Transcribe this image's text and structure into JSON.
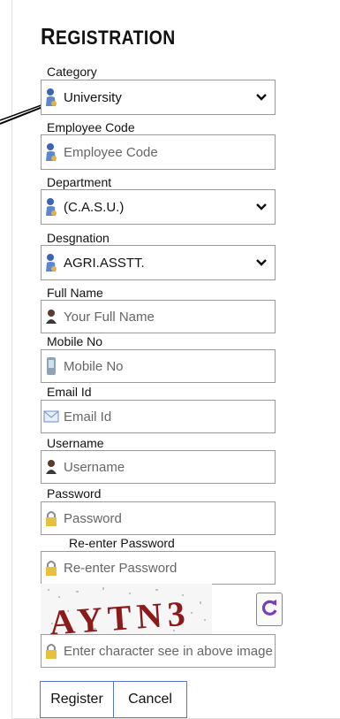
{
  "form": {
    "title_first": "R",
    "title_rest": "EGISTRATION",
    "category": {
      "label": "Category",
      "value": "University"
    },
    "employee_code": {
      "label": "Employee Code",
      "placeholder": "Employee Code"
    },
    "department": {
      "label": "Department",
      "value": "(C.A.S.U.)"
    },
    "designation": {
      "label": "Desgnation",
      "value": "AGRI.ASSTT."
    },
    "full_name": {
      "label": "Full Name",
      "placeholder": "Your Full Name"
    },
    "mobile": {
      "label": "Mobile No",
      "placeholder": "Mobile No"
    },
    "email": {
      "label": "Email Id",
      "placeholder": "Email Id"
    },
    "username": {
      "label": "Username",
      "placeholder": "Username"
    },
    "password": {
      "label": "Password",
      "placeholder": "Password"
    },
    "reenter_password": {
      "label": "Re-enter Password",
      "placeholder": "Re-enter Password"
    },
    "captcha": {
      "text": "AYTN3",
      "placeholder": "Enter character see in above image"
    },
    "buttons": {
      "register": "Register",
      "cancel": "Cancel"
    }
  },
  "colors": {
    "border": "#9a9a9a",
    "button_border": "#5577cc",
    "refresh_icon": "#7a3fb0",
    "captcha_text": "#8b1a1a"
  }
}
